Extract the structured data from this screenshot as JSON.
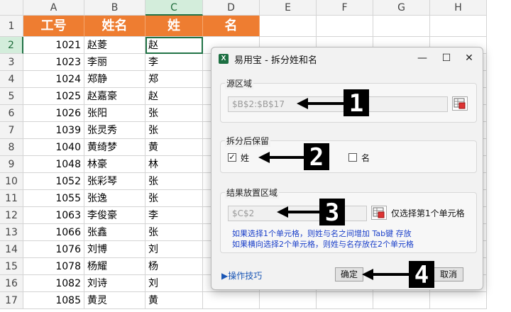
{
  "columns": [
    "A",
    "B",
    "C",
    "D",
    "E",
    "F",
    "G",
    "H"
  ],
  "selected_column": "C",
  "row_numbers": [
    "1",
    "2",
    "3",
    "4",
    "5",
    "6",
    "7",
    "8",
    "9",
    "10",
    "11",
    "12",
    "13",
    "14",
    "15",
    "16",
    "17"
  ],
  "selected_row": "2",
  "header_row": [
    "工号",
    "姓名",
    "姓",
    "名"
  ],
  "rows": [
    {
      "id": "1021",
      "name": "赵菱",
      "surname": "赵"
    },
    {
      "id": "1023",
      "name": "李丽",
      "surname": "李"
    },
    {
      "id": "1024",
      "name": "郑静",
      "surname": "郑"
    },
    {
      "id": "1025",
      "name": "赵嘉豪",
      "surname": "赵"
    },
    {
      "id": "1026",
      "name": "张阳",
      "surname": "张"
    },
    {
      "id": "1039",
      "name": "张灵秀",
      "surname": "张"
    },
    {
      "id": "1040",
      "name": "黄绮梦",
      "surname": "黄"
    },
    {
      "id": "1048",
      "name": "林豪",
      "surname": "林"
    },
    {
      "id": "1052",
      "name": "张彩琴",
      "surname": "张"
    },
    {
      "id": "1055",
      "name": "张逸",
      "surname": "张"
    },
    {
      "id": "1063",
      "name": "李俊豪",
      "surname": "李"
    },
    {
      "id": "1066",
      "name": "张鑫",
      "surname": "张"
    },
    {
      "id": "1076",
      "name": "刘博",
      "surname": "刘"
    },
    {
      "id": "1078",
      "name": "杨耀",
      "surname": "杨"
    },
    {
      "id": "1082",
      "name": "刘诗",
      "surname": "刘"
    },
    {
      "id": "1085",
      "name": "黄灵",
      "surname": "黄"
    }
  ],
  "dialog": {
    "app_icon": "X",
    "title": "易用宝 - 拆分姓和名",
    "minimize": "—",
    "maximize": "☐",
    "close": "✕",
    "source_label": "源区域",
    "source_value": "$B$2:$B$17",
    "keep_label": "拆分后保留",
    "keep_surname_label": "姓",
    "keep_surname_checked": "✓",
    "keep_given_label": "名",
    "result_label": "结果放置区域",
    "result_value": "$C$2",
    "result_hint": "仅选择第1个单元格",
    "note1": "如果选择1个单元格，则姓与名之间增加 Tab键 存放",
    "note2": "如果横向选择2个单元格，则姓与名存放在2个单元格",
    "tips_link": "▶操作技巧",
    "ok_button": "确定",
    "cancel_button": "取消"
  },
  "callouts": [
    "1",
    "2",
    "3",
    "4"
  ],
  "colors": {
    "header_fill": "#ee7d31",
    "selection": "#217346",
    "note_text": "#1a3fc9"
  }
}
